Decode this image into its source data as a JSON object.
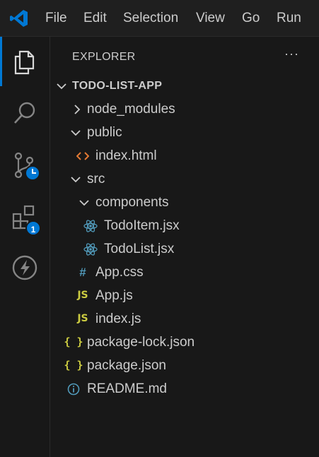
{
  "titlebar": {
    "menu": [
      "File",
      "Edit",
      "Selection",
      "View",
      "Go",
      "Run"
    ],
    "brand_color": "#0078d4"
  },
  "activity_bar": {
    "items": [
      {
        "icon": "explorer-icon",
        "active": true
      },
      {
        "icon": "search-icon",
        "active": false
      },
      {
        "icon": "source-control-icon",
        "active": false
      },
      {
        "icon": "extensions-icon",
        "active": false,
        "badge": "1"
      },
      {
        "icon": "bolt-icon",
        "active": false
      }
    ]
  },
  "explorer": {
    "title": "EXPLORER",
    "more": "···",
    "root": "TODO-LIST-APP",
    "tree": [
      {
        "label": "node_modules",
        "type": "folder",
        "expanded": false
      },
      {
        "label": "public",
        "type": "folder",
        "expanded": true
      },
      {
        "label": "index.html",
        "type": "html-file"
      },
      {
        "label": "src",
        "type": "folder",
        "expanded": true
      },
      {
        "label": "components",
        "type": "folder",
        "expanded": true
      },
      {
        "label": "TodoItem.jsx",
        "type": "react-file"
      },
      {
        "label": "TodoList.jsx",
        "type": "react-file"
      },
      {
        "label": "App.css",
        "type": "css-file"
      },
      {
        "label": "App.js",
        "type": "js-file"
      },
      {
        "label": "index.js",
        "type": "js-file"
      },
      {
        "label": "package-lock.json",
        "type": "json-file"
      },
      {
        "label": "package.json",
        "type": "json-file"
      },
      {
        "label": "README.md",
        "type": "info-file"
      }
    ],
    "icon_glyphs": {
      "js": "JS",
      "css": "#",
      "json": "{ }"
    },
    "colors": {
      "html": "#e37933",
      "react": "#519aba",
      "css": "#519aba",
      "js": "#cbcb41",
      "json": "#cbcb41",
      "info": "#519aba"
    }
  }
}
